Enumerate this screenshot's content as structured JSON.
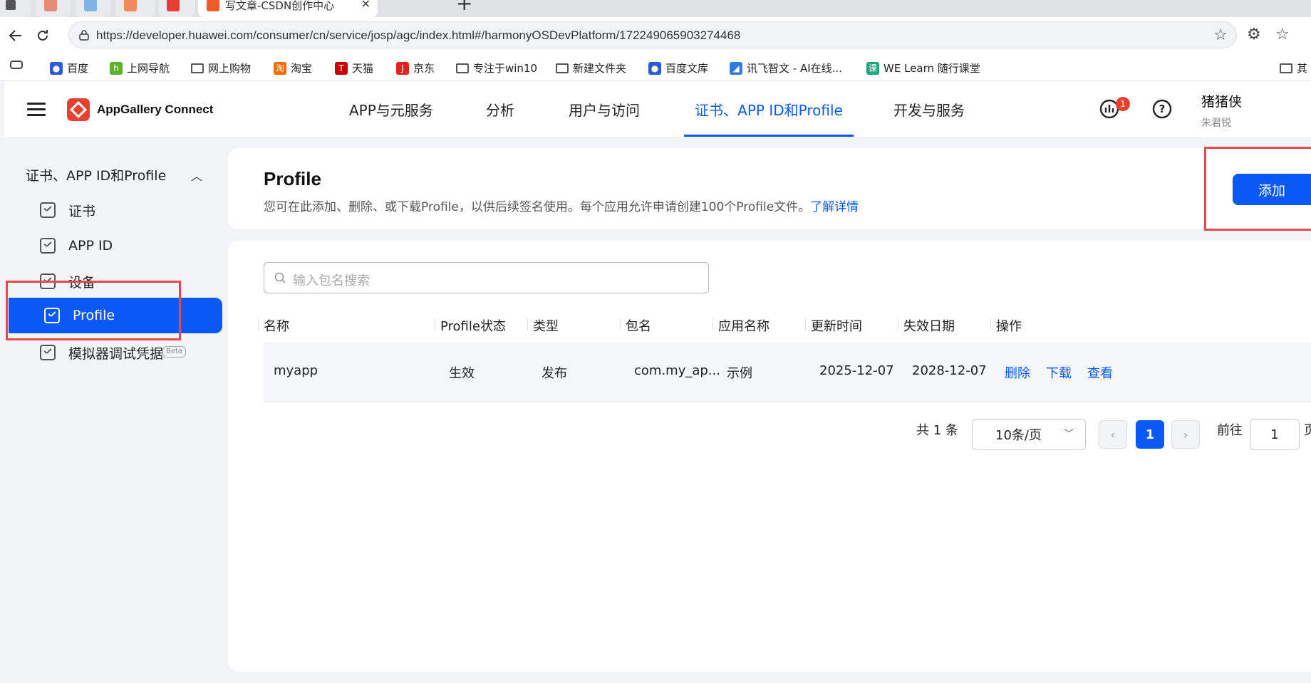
{
  "browser": {
    "tabs": [
      {
        "label": "写文章-CSDN创作中心",
        "active": true
      }
    ],
    "url": "https://developer.huawei.com/consumer/cn/service/josp/agc/index.html#/harmonyOSDevPlatform/172249065903274468",
    "bookmarks": [
      "百度",
      "上网导航",
      "网上购物",
      "淘宝",
      "天猫",
      "京东",
      "专注于win10",
      "新建文件夹",
      "百度文库",
      "讯飞智文 - AI在线...",
      "WE Learn 随行课堂",
      "其"
    ]
  },
  "header": {
    "brand": "AppGallery Connect",
    "nav": [
      "APP与元服务",
      "分析",
      "用户与访问",
      "证书、APP ID和Profile",
      "开发与服务"
    ],
    "active_nav": "证书、APP ID和Profile",
    "notification_count": "1",
    "user_name": "猪猪侠",
    "user_sub": "朱君锐"
  },
  "sidebar": {
    "group": "证书、APP ID和Profile",
    "items": [
      {
        "label": "证书"
      },
      {
        "label": "APP ID"
      },
      {
        "label": "设备"
      },
      {
        "label": "Profile"
      },
      {
        "label": "模拟器调试凭据"
      }
    ],
    "beta_badge": "Beta",
    "active": "Profile"
  },
  "page": {
    "title": "Profile",
    "description": "您可在此添加、删除、或下载Profile，以供后续签名使用。每个应用允许申请创建100个Profile文件。",
    "learn_more": "了解详情",
    "add_button": "添加"
  },
  "search": {
    "placeholder": "输入包名搜索"
  },
  "table": {
    "columns": [
      "名称",
      "Profile状态",
      "类型",
      "包名",
      "应用名称",
      "更新时间",
      "失效日期",
      "操作"
    ],
    "rows": [
      {
        "name": "myapp",
        "status": "生效",
        "type": "发布",
        "package": "com.my_ap...",
        "app_name": "示例",
        "updated": "2025-12-07",
        "expires": "2028-12-07",
        "actions": [
          "删除",
          "下载",
          "查看"
        ]
      }
    ]
  },
  "pagination": {
    "total": "共 1 条",
    "page_size": "10条/页",
    "current_page": "1",
    "goto_label": "前往",
    "goto_value": "1",
    "page_suffix": "页"
  },
  "colors": {
    "primary": "#0a59f7",
    "highlight": "#e8494f"
  }
}
